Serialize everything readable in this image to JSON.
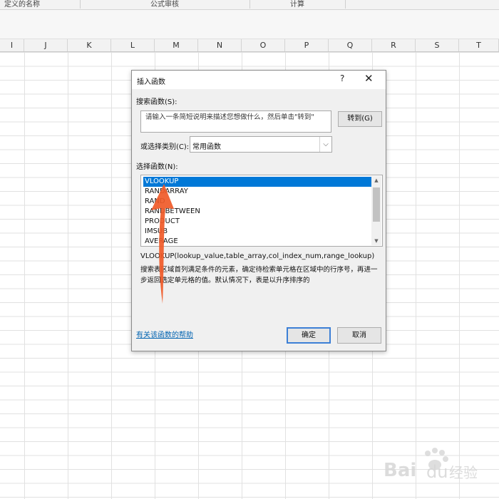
{
  "ribbon": {
    "groups": [
      "定义的名称",
      "公式审核",
      "计算"
    ]
  },
  "columns": [
    "I",
    "J",
    "K",
    "L",
    "M",
    "N",
    "O",
    "P",
    "Q",
    "R",
    "S",
    "T"
  ],
  "dialog": {
    "title": "插入函数",
    "help_icon": "?",
    "close_icon": "✕",
    "search_label": "搜索函数(S):",
    "search_value": "请输入一条简短说明来描述您想做什么，然后单击\"转到\"",
    "goto_button": "转到(G)",
    "category_label": "或选择类别(C):",
    "category_value": "常用函数",
    "function_list_label": "选择函数(N):",
    "functions": [
      "VLOOKUP",
      "RANDARRAY",
      "RAND",
      "RANDBETWEEN",
      "PRODUCT",
      "IMSUB",
      "AVERAGE"
    ],
    "selected_function": "VLOOKUP",
    "signature": "VLOOKUP(lookup_value,table_array,col_index_num,range_lookup)",
    "description": "搜索表区域首列满足条件的元素，确定待检索单元格在区域中的行序号，再进一步返回选定单元格的值。默认情况下，表是以升序排序的",
    "help_link": "有关该函数的帮助",
    "ok_button": "确定",
    "cancel_button": "取消"
  },
  "annotation": {
    "arrow_color": "#f05a28"
  },
  "watermark": {
    "text": "Bai经验"
  }
}
